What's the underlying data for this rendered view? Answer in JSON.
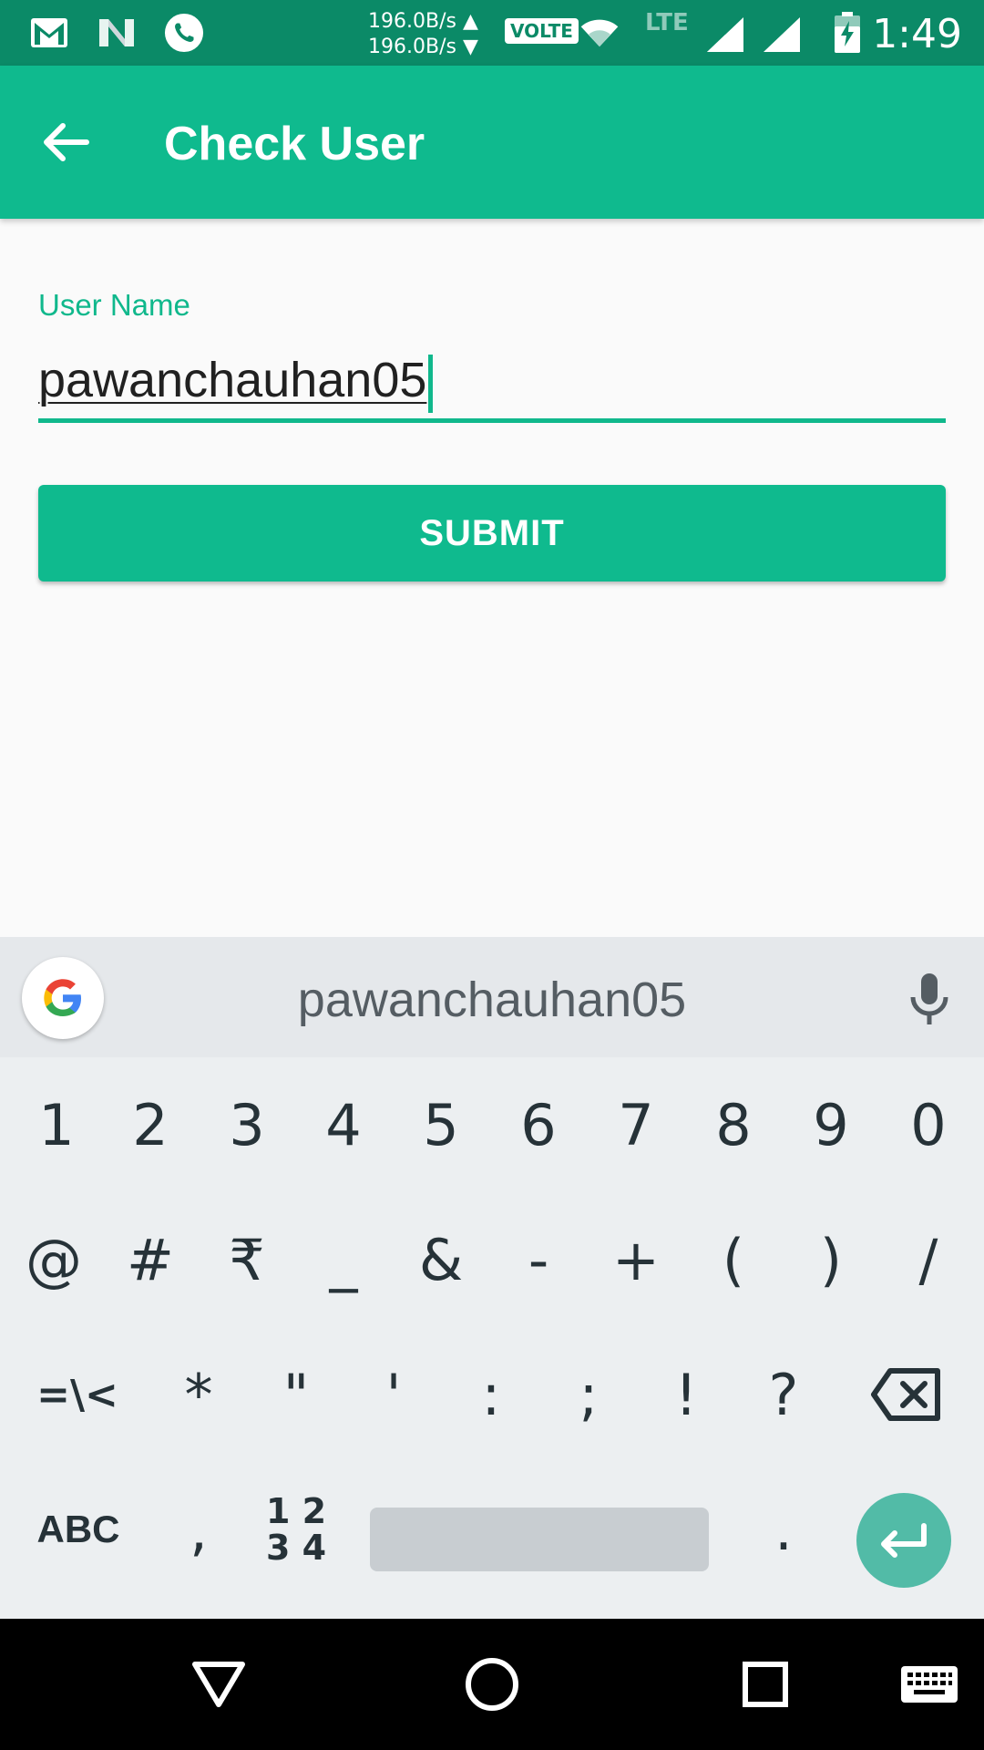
{
  "status_bar": {
    "net_up": "196.0B/s ▲",
    "net_down": "196.0B/s ▼",
    "volte": "VOLTE",
    "lte": "LTE",
    "time": "1:49",
    "icons": [
      "gmail-icon",
      "n-icon",
      "phone-icon",
      "wifi-icon",
      "signal-icon",
      "signal-icon",
      "battery-charging-icon"
    ]
  },
  "app_bar": {
    "title": "Check User",
    "back_icon": "arrow-back-icon"
  },
  "form": {
    "username_label": "User Name",
    "username_value": "pawanchauhan05",
    "submit_label": "SUBMIT"
  },
  "keyboard": {
    "suggestion": "pawanchauhan05",
    "row1": [
      "1",
      "2",
      "3",
      "4",
      "5",
      "6",
      "7",
      "8",
      "9",
      "0"
    ],
    "row2": [
      "@",
      "#",
      "₹",
      "_",
      "&",
      "-",
      "+",
      "(",
      ")",
      "/"
    ],
    "row3": [
      "=\\<",
      "*",
      "\"",
      "'",
      ":",
      ";",
      "!",
      "?"
    ],
    "abc_label": "ABC",
    "comma": ",",
    "num_top": "1 2",
    "num_bottom": "3 4",
    "period": "."
  },
  "colors": {
    "primary": "#0fba8e",
    "primary_dark": "#0b8a67",
    "accent": "#10b88c",
    "enter": "#52bba7"
  }
}
